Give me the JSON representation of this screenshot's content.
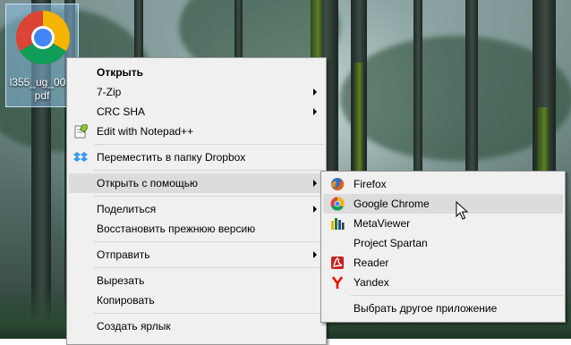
{
  "desktop": {
    "icon_label": "l355_ug_00...pdf"
  },
  "context_menu": {
    "items": [
      {
        "label": "Открыть",
        "bold": true
      },
      {
        "label": "7-Zip",
        "submenu": true
      },
      {
        "label": "CRC SHA",
        "submenu": true
      },
      {
        "label": "Edit with Notepad++",
        "icon": "notepad-plus-icon"
      },
      {
        "label": "Переместить в папку Dropbox",
        "icon": "dropbox-icon"
      },
      {
        "label": "Открыть с помощью",
        "submenu": true,
        "highlighted": true
      },
      {
        "label": "Поделиться",
        "submenu": true
      },
      {
        "label": "Восстановить прежнюю версию"
      },
      {
        "label": "Отправить",
        "submenu": true
      },
      {
        "label": "Вырезать"
      },
      {
        "label": "Копировать"
      },
      {
        "label": "Создать ярлык"
      }
    ]
  },
  "open_with_submenu": {
    "items": [
      {
        "label": "Firefox",
        "icon": "firefox-icon"
      },
      {
        "label": "Google Chrome",
        "icon": "chrome-icon",
        "highlighted": true
      },
      {
        "label": "MetaViewer",
        "icon": "metaviewer-icon"
      },
      {
        "label": "Project Spartan"
      },
      {
        "label": "Reader",
        "icon": "acrobat-reader-icon"
      },
      {
        "label": "Yandex",
        "icon": "yandex-icon"
      },
      {
        "label": "Выбрать другое приложение"
      }
    ]
  },
  "colors": {
    "menu_bg": "#f0f0f0",
    "menu_highlight": "#dcdcdc",
    "icon_selection": "#99d1ff"
  }
}
